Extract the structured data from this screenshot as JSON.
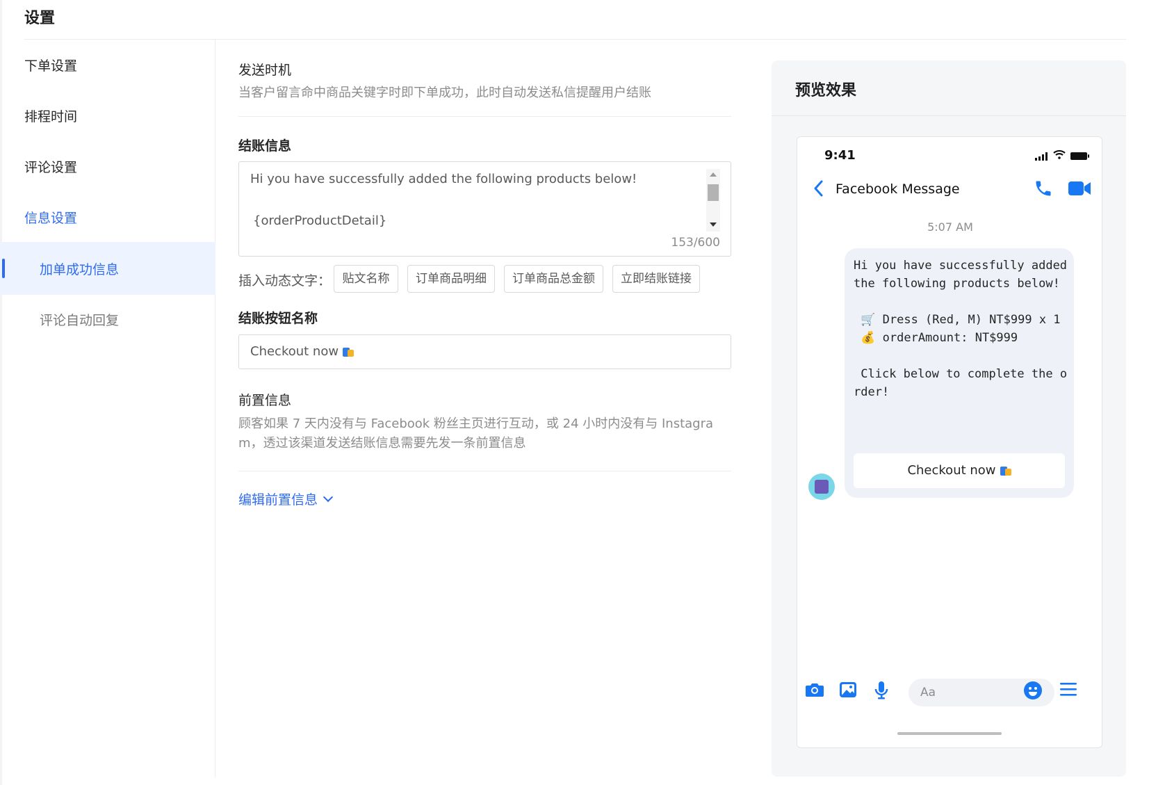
{
  "page": {
    "title": "设置"
  },
  "sidebar": {
    "items": [
      {
        "label": "下单设置"
      },
      {
        "label": "排程时间"
      },
      {
        "label": "评论设置"
      },
      {
        "label": "信息设置"
      }
    ],
    "sub_items": [
      {
        "label": "加单成功信息",
        "selected": true
      },
      {
        "label": "评论自动回复",
        "selected": false
      }
    ]
  },
  "main": {
    "send_timing": {
      "label": "发送时机",
      "desc": "当客户留言命中商品关键字时即下单成功，此时自动发送私信提醒用户结账"
    },
    "checkout_info": {
      "label": "结账信息",
      "line1": "Hi you have successfully added the following products below!",
      "line2": "{orderProductDetail}",
      "char_count": "153/600"
    },
    "insert": {
      "label": "插入动态文字：",
      "tags": [
        "贴文名称",
        "订单商品明细",
        "订单商品总金额",
        "立即结账链接"
      ]
    },
    "button_name": {
      "label": "结账按钮名称",
      "value": "Checkout now"
    },
    "pre_info": {
      "label": "前置信息",
      "desc": "顾客如果 7 天内没有与 Facebook 粉丝主页进行互动，或 24 小时内没有与 Instagram，透过该渠道发送结账信息需要先发一条前置信息",
      "edit_link": "编辑前置信息"
    }
  },
  "preview": {
    "title": "预览效果",
    "phone": {
      "time": "9:41",
      "chat_title": "Facebook Message",
      "msg_time": "5:07 AM",
      "bubble_text": "Hi you have successfully added the following products below!\n\n 🛒 Dress (Red, M) NT$999 x 1\n 💰 orderAmount: NT$999\n\n Click below to complete the order!",
      "button": "Checkout now",
      "input_placeholder": "Aa"
    }
  },
  "colors": {
    "accent": "#2f6bf0",
    "messenger_blue": "#1877f2"
  },
  "icons": [
    "back-arrow-icon",
    "phone-call-icon",
    "video-camera-icon",
    "camera-icon",
    "image-icon",
    "microphone-icon",
    "emoji-icon",
    "menu-icon",
    "chevron-down-icon",
    "shopping-bag-icon"
  ]
}
